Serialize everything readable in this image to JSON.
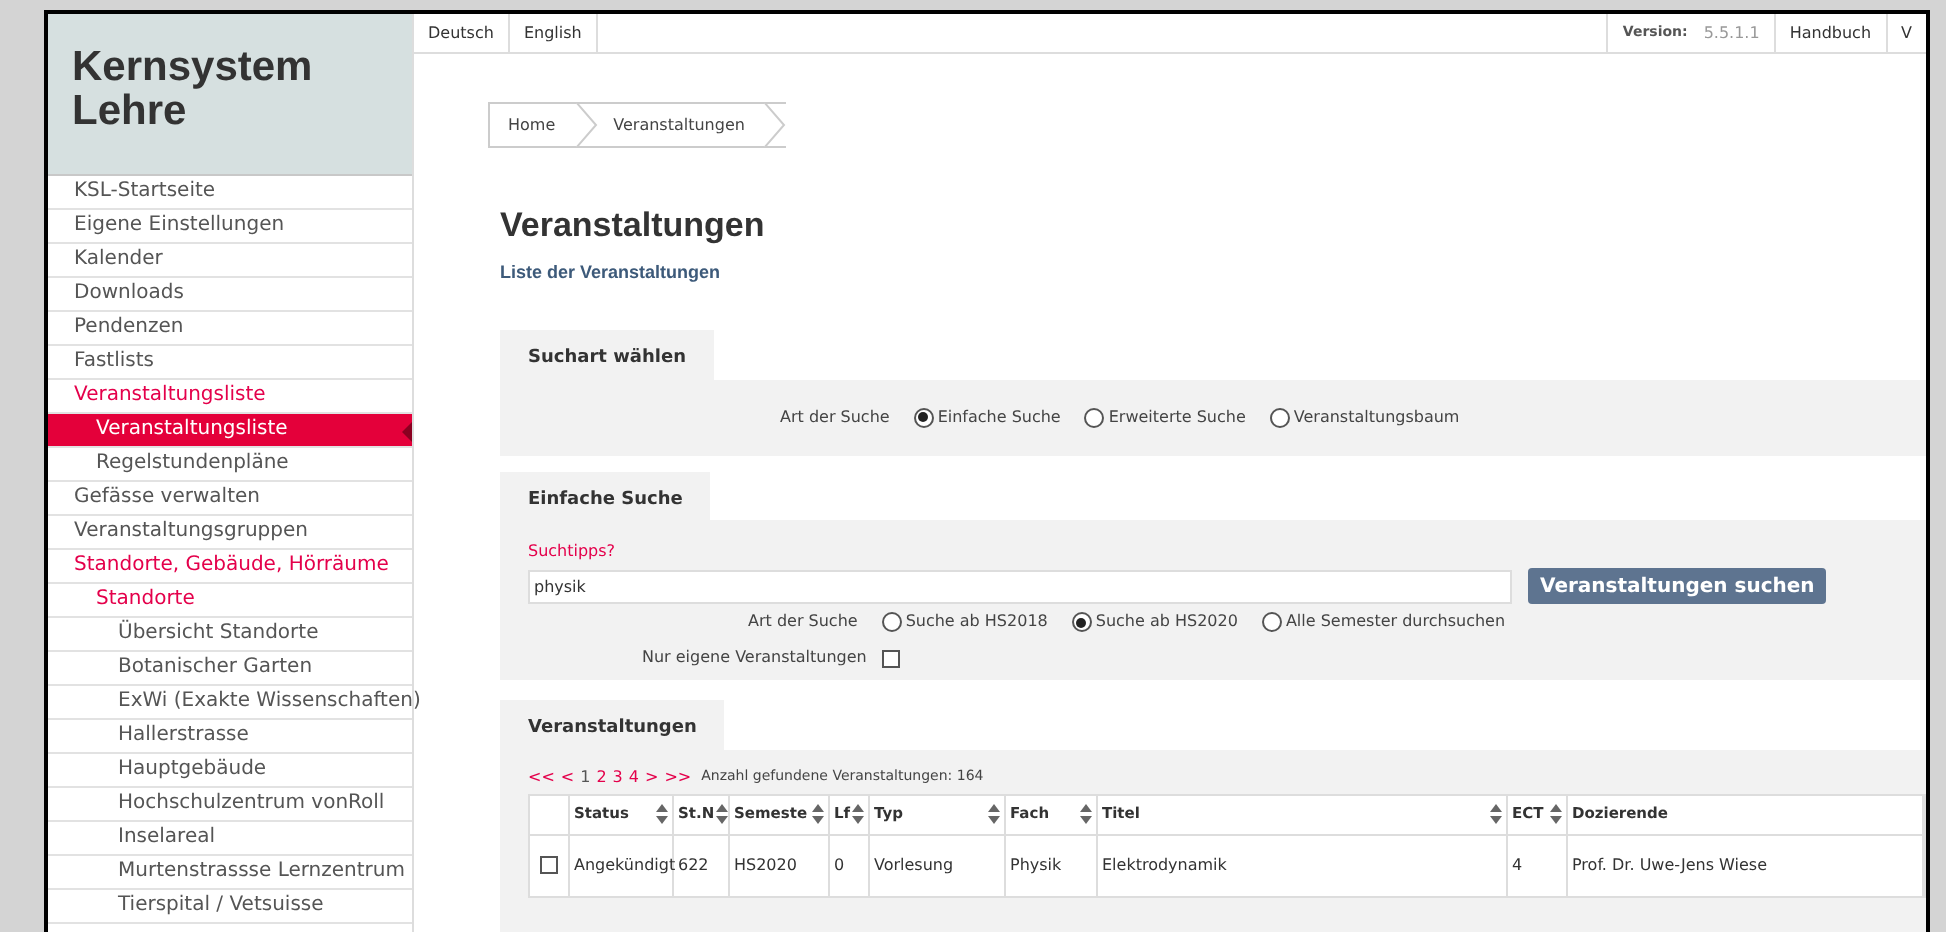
{
  "app_title": "Kernsystem Lehre",
  "nav": [
    {
      "label": "KSL-Startseite",
      "selected": false,
      "active": false
    },
    {
      "label": "Eigene Einstellungen",
      "selected": false,
      "active": false
    },
    {
      "label": "Kalender",
      "selected": false,
      "active": false
    },
    {
      "label": "Downloads",
      "selected": false,
      "active": false
    },
    {
      "label": "Pendenzen",
      "selected": false,
      "active": false
    },
    {
      "label": "Fastlists",
      "selected": false,
      "active": false
    },
    {
      "label": "Veranstaltungsliste",
      "selected": false,
      "active": true,
      "children": [
        {
          "label": "Veranstaltungsliste",
          "selected": true
        },
        {
          "label": "Regelstundenpläne",
          "selected": false,
          "active": false
        }
      ]
    },
    {
      "label": "Gefässe verwalten",
      "selected": false,
      "active": false
    },
    {
      "label": "Veranstaltungsgruppen",
      "selected": false,
      "active": false
    },
    {
      "label": "Standorte, Gebäude, Hörräume",
      "selected": false,
      "active": true,
      "children": [
        {
          "label": "Standorte",
          "selected": false,
          "active": true,
          "children": [
            {
              "label": "Übersicht Standorte",
              "selected": false,
              "active": false
            },
            {
              "label": "Botanischer Garten",
              "selected": false,
              "active": false
            },
            {
              "label": "ExWi (Exakte Wissenschaften)",
              "selected": false,
              "active": false
            },
            {
              "label": "Hallerstrasse",
              "selected": false,
              "active": false
            },
            {
              "label": "Hauptgebäude",
              "selected": false,
              "active": false
            },
            {
              "label": "Hochschulzentrum vonRoll",
              "selected": false,
              "active": false
            },
            {
              "label": "Inselareal",
              "selected": false,
              "active": false
            },
            {
              "label": "Murtenstrassse Lernzentrum",
              "selected": false,
              "active": false
            },
            {
              "label": "Tierspital / Vetsuisse",
              "selected": false,
              "active": false
            }
          ]
        }
      ]
    }
  ],
  "top_bar": {
    "languages": [
      "Deutsch",
      "English"
    ],
    "version_label": "Version:",
    "version": "5.5.1.1",
    "links": [
      "Handbuch",
      "V"
    ]
  },
  "breadcrumb": [
    "Home",
    "Veranstaltungen"
  ],
  "page_title": "Veranstaltungen",
  "subtitle_link": "Liste der Veranstaltungen",
  "search_type_panel": {
    "title": "Suchart wählen",
    "label": "Art der Suche",
    "options": [
      {
        "label": "Einfache Suche",
        "selected": true
      },
      {
        "label": "Erweiterte Suche",
        "selected": false
      },
      {
        "label": "Veranstaltungsbaum",
        "selected": false
      }
    ]
  },
  "simple_search_panel": {
    "title": "Einfache Suche",
    "tips_link": "Suchtipps?",
    "query": "physik",
    "button": "Veranstaltungen suchen",
    "scope_label": "Art der Suche",
    "scope_options": [
      {
        "label": "Suche ab HS2018",
        "selected": false
      },
      {
        "label": "Suche ab HS2020",
        "selected": true
      },
      {
        "label": "Alle Semester durchsuchen",
        "selected": false
      }
    ],
    "own_label": "Nur eigene Veranstaltungen",
    "own_checked": false
  },
  "results_panel": {
    "title": "Veranstaltungen",
    "pager": [
      {
        "label": "<<",
        "selected": false
      },
      {
        "label": "<",
        "selected": false
      },
      {
        "label": "1",
        "selected": true
      },
      {
        "label": "2",
        "selected": false
      },
      {
        "label": "3",
        "selected": false
      },
      {
        "label": "4",
        "selected": false
      },
      {
        "label": ">",
        "selected": false
      },
      {
        "label": ">>",
        "selected": false
      }
    ],
    "count": "Anzahl gefundene Veranstaltungen: 164",
    "columns": [
      {
        "label": "Status",
        "sortable": true
      },
      {
        "label": "St.N",
        "sortable": true
      },
      {
        "label": "Semeste",
        "sortable": true
      },
      {
        "label": "Lf",
        "sortable": true
      },
      {
        "label": "Typ",
        "sortable": true
      },
      {
        "label": "Fach",
        "sortable": true
      },
      {
        "label": "Titel",
        "sortable": true
      },
      {
        "label": "ECT",
        "sortable": true
      },
      {
        "label": "Dozierende",
        "sortable": false
      }
    ],
    "rows": [
      {
        "checked": false,
        "cells": [
          "Angekündigt",
          "622",
          "HS2020",
          "0",
          "Vorlesung",
          "Physik",
          "Elektrodynamik",
          "4",
          "Prof. Dr. Uwe-Jens Wiese"
        ]
      }
    ]
  }
}
